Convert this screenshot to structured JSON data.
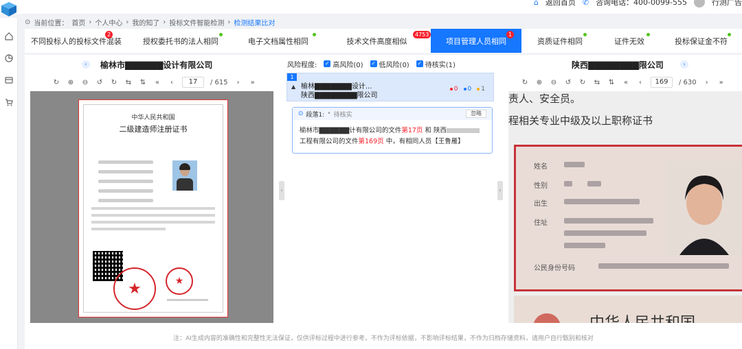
{
  "header": {
    "back_home": "返回首页",
    "hotline": "咨询电话：400-0099-555",
    "user": "行测广告"
  },
  "breadcrumb": {
    "label": "当前位置：",
    "items": [
      "首页",
      "个人中心",
      "我的知了",
      "投标文件智能检测",
      "检测结果比对"
    ]
  },
  "tabs": [
    {
      "label": "不同投标人的投标文件混装",
      "badge": "2"
    },
    {
      "label": "授权委托书的法人相同",
      "dot": true
    },
    {
      "label": "电子文档属性相同",
      "dot": true
    },
    {
      "label": "技术文件高度相似",
      "badge": "4753"
    },
    {
      "label": "项目管理人员相同",
      "badge": "1",
      "active": true
    },
    {
      "label": "资质证件相同",
      "dot": true
    },
    {
      "label": "证件无效",
      "dot": true
    },
    {
      "label": "投标保证金不符",
      "dot": true
    }
  ],
  "left_pane": {
    "title": "榆林市▇▇▇▇▇▇设计有限公司",
    "page": "17",
    "total": "/ 615"
  },
  "right_pane": {
    "title": "陕西▇▇▇▇▇▇▇▇限公司",
    "page": "169",
    "total": "/ 630"
  },
  "risk": {
    "label": "风险程度:",
    "high": "高风险(0)",
    "low": "低风险(0)",
    "pending": "待核实(1)"
  },
  "compare_card": {
    "index": "1",
    "line1": "榆林▇▇▇▇▇▇▇设计...",
    "line2": "陕西▇▇▇▇▇▇▇▇限公司",
    "count_high": "0",
    "count_low": "0",
    "count_pending": "1"
  },
  "segment": {
    "label": "段落1:",
    "status": "待核实",
    "ignore": "忽略",
    "text_a": "榆林市▇▇▇▇▇▇计有限公司的文件",
    "page_a": "第17页",
    "text_and": "和 陕西",
    "text_b": "工程有限公司的文件",
    "page_b": "第169页",
    "text_end": "中，有相同人员【王鲁雁】"
  },
  "certificate": {
    "title1": "中华人民共和国",
    "title2": "二级建造师注册证书"
  },
  "right_doc": {
    "line1": "责人、安全员。",
    "line2": "程相关专业中级及以上职称证书",
    "id_fields": [
      "姓名",
      "性别",
      "出生",
      "住址",
      "公民身份号码"
    ],
    "id_back_title": "中华人民共和国"
  },
  "footer_note": "注：AI生成内容的准确性和完整性无法保证，仅供评标过程中进行参考，不作为评标依据，不影响评标结果，不作为归档存储资料，请用户自行甄别和核对",
  "colors": {
    "primary": "#1677ff",
    "danger": "#f5222d",
    "success": "#52c41a"
  }
}
